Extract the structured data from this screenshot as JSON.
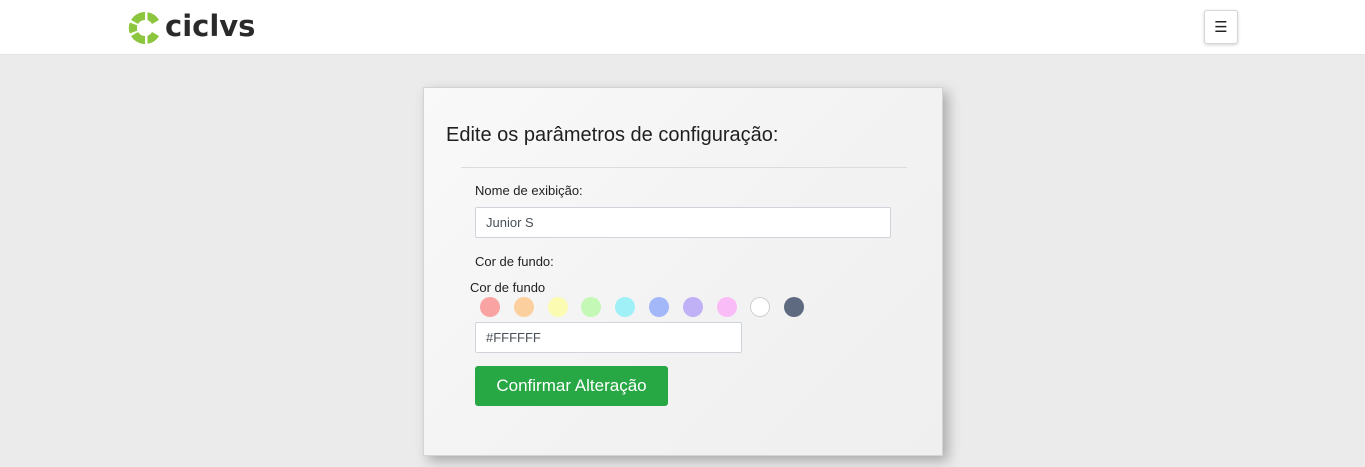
{
  "header": {
    "logo_text": "ciclvs",
    "logo_accent_color": "#8cc63f",
    "menu_icon_glyph": "☰"
  },
  "form": {
    "title": "Edite os parâmetros de configuração:",
    "display_name_label": "Nome de exibição:",
    "display_name_value": "Junior S",
    "background_label": "Cor de fundo:",
    "background_picker_label": "Cor de fundo",
    "background_value": "#FFFFFF",
    "swatch_colors": [
      "#f9a3a3",
      "#fccf9e",
      "#fbfbb1",
      "#c4f8b6",
      "#9ff1f7",
      "#a3b8f8",
      "#c0b1f7",
      "#f9bcf6",
      "#ffffff",
      "#5e6a80"
    ],
    "confirm_label": "Confirmar Alteração",
    "confirm_color": "#28a745"
  }
}
